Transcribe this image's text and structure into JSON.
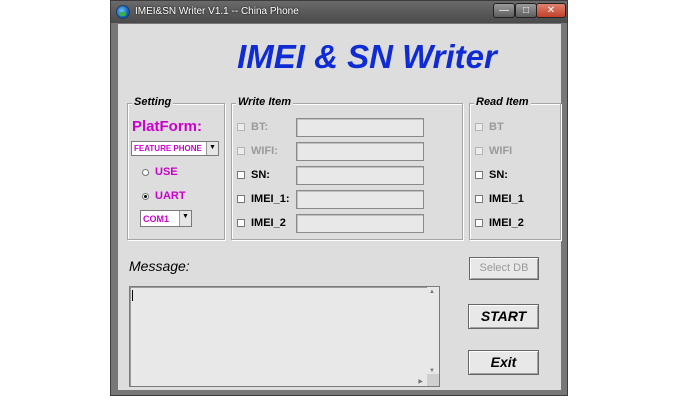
{
  "window": {
    "title": "IMEI&SN Writer V1.1 -- China Phone"
  },
  "app_title": "IMEI & SN Writer",
  "setting": {
    "title": "Setting",
    "platform_label": "PlatForm:",
    "platform_selected": "FEATURE PHONE",
    "radio_use": "USE",
    "radio_uart": "UART",
    "selected_mode": "UART",
    "com_selected": "COM1"
  },
  "write_item": {
    "title": "Write Item",
    "items": [
      {
        "label": "BT:",
        "enabled": false
      },
      {
        "label": "WIFI:",
        "enabled": false
      },
      {
        "label": "SN:",
        "enabled": true
      },
      {
        "label": "IMEI_1:",
        "enabled": true
      },
      {
        "label": "IMEI_2",
        "enabled": true
      }
    ]
  },
  "read_item": {
    "title": "Read Item",
    "items": [
      {
        "label": "BT",
        "enabled": false
      },
      {
        "label": "WIFI",
        "enabled": false
      },
      {
        "label": "SN:",
        "enabled": true
      },
      {
        "label": "IMEI_1",
        "enabled": true
      },
      {
        "label": "IMEI_2",
        "enabled": true
      }
    ]
  },
  "message": {
    "label": "Message:",
    "content": ""
  },
  "buttons": {
    "select_db": "Select DB",
    "start": "START",
    "exit": "Exit"
  },
  "colors": {
    "title_blue": "#0f2bd4",
    "magenta": "#cc00cc",
    "background": "#dddddd"
  }
}
